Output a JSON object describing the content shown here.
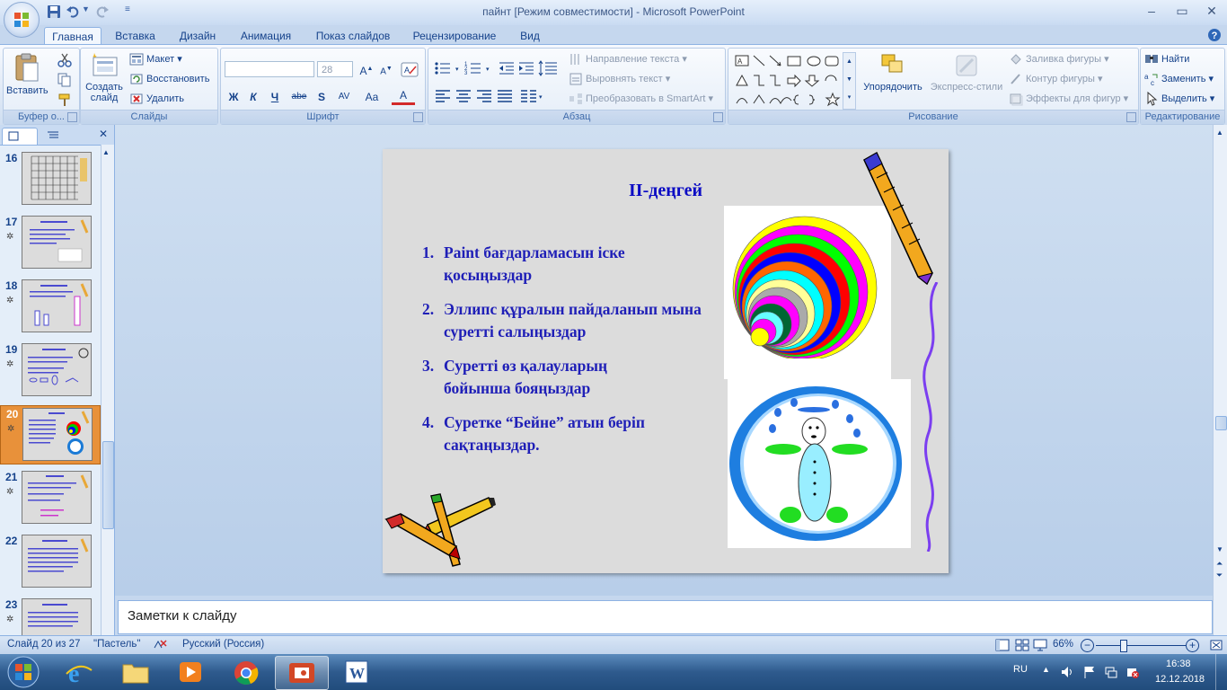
{
  "window": {
    "title": "пайнт [Режим совместимости] - Microsoft PowerPoint",
    "controls": {
      "minimize": "–",
      "restore": "▭",
      "close": "✕"
    }
  },
  "tabs": [
    {
      "label": "Главная",
      "active": true
    },
    {
      "label": "Вставка"
    },
    {
      "label": "Дизайн"
    },
    {
      "label": "Анимация"
    },
    {
      "label": "Показ слайдов"
    },
    {
      "label": "Рецензирование"
    },
    {
      "label": "Вид"
    }
  ],
  "ribbon": {
    "clipboard": {
      "label": "Буфер о...",
      "paste": "Вставить"
    },
    "slides": {
      "label": "Слайды",
      "new_slide_1": "Создать",
      "new_slide_2": "слайд",
      "layout": "Макет",
      "reset": "Восстановить",
      "delete": "Удалить"
    },
    "font": {
      "label": "Шрифт",
      "font_name": "",
      "font_size": "28",
      "bold": "Ж",
      "italic": "К",
      "underline": "Ч",
      "strike": "abe",
      "shadow": "S",
      "spacing": "AV",
      "case": "Aa",
      "color": "A"
    },
    "paragraph": {
      "label": "Абзац",
      "text_direction": "Направление текста",
      "align_text": "Выровнять текст",
      "smartart": "Преобразовать в SmartArt"
    },
    "drawing": {
      "label": "Рисование",
      "arrange": "Упорядочить",
      "quick_styles": "Экспресс-стили",
      "fill": "Заливка фигуры",
      "outline": "Контур фигуры",
      "effects": "Эффекты для фигур"
    },
    "editing": {
      "label": "Редактирование",
      "find": "Найти",
      "replace": "Заменить",
      "select": "Выделить"
    }
  },
  "thumbnails": [
    {
      "num": "16"
    },
    {
      "num": "17"
    },
    {
      "num": "18"
    },
    {
      "num": "19"
    },
    {
      "num": "20",
      "selected": true
    },
    {
      "num": "21"
    },
    {
      "num": "22"
    },
    {
      "num": "23"
    }
  ],
  "slide": {
    "title": "ІІ-деңгей",
    "items": [
      {
        "n": "1.",
        "text": "Paint бағдарламасын іске қосыңыздар"
      },
      {
        "n": "2.",
        "text": "Эллипс құралын пайдаланып мына суретті салыңыздар"
      },
      {
        "n": "3.",
        "text": "Суретті өз қалауларың бойынша бояңыздар"
      },
      {
        "n": "4.",
        "text": "Суретке “Бейне” атын беріп сақтаңыздар."
      }
    ]
  },
  "notes": {
    "placeholder": "Заметки к слайду"
  },
  "status": {
    "slide": "Слайд 20 из 27",
    "theme": "\"Пастель\"",
    "language": "Русский (Россия)",
    "zoom": "66%"
  },
  "taskbar": {
    "lang": "RU",
    "time": "16:38",
    "date": "12.12.2018"
  },
  "colors": {
    "ribbon_blue": "#15428b",
    "slide_text": "#1f1fb7",
    "thumb_selected": "#e8913a"
  }
}
